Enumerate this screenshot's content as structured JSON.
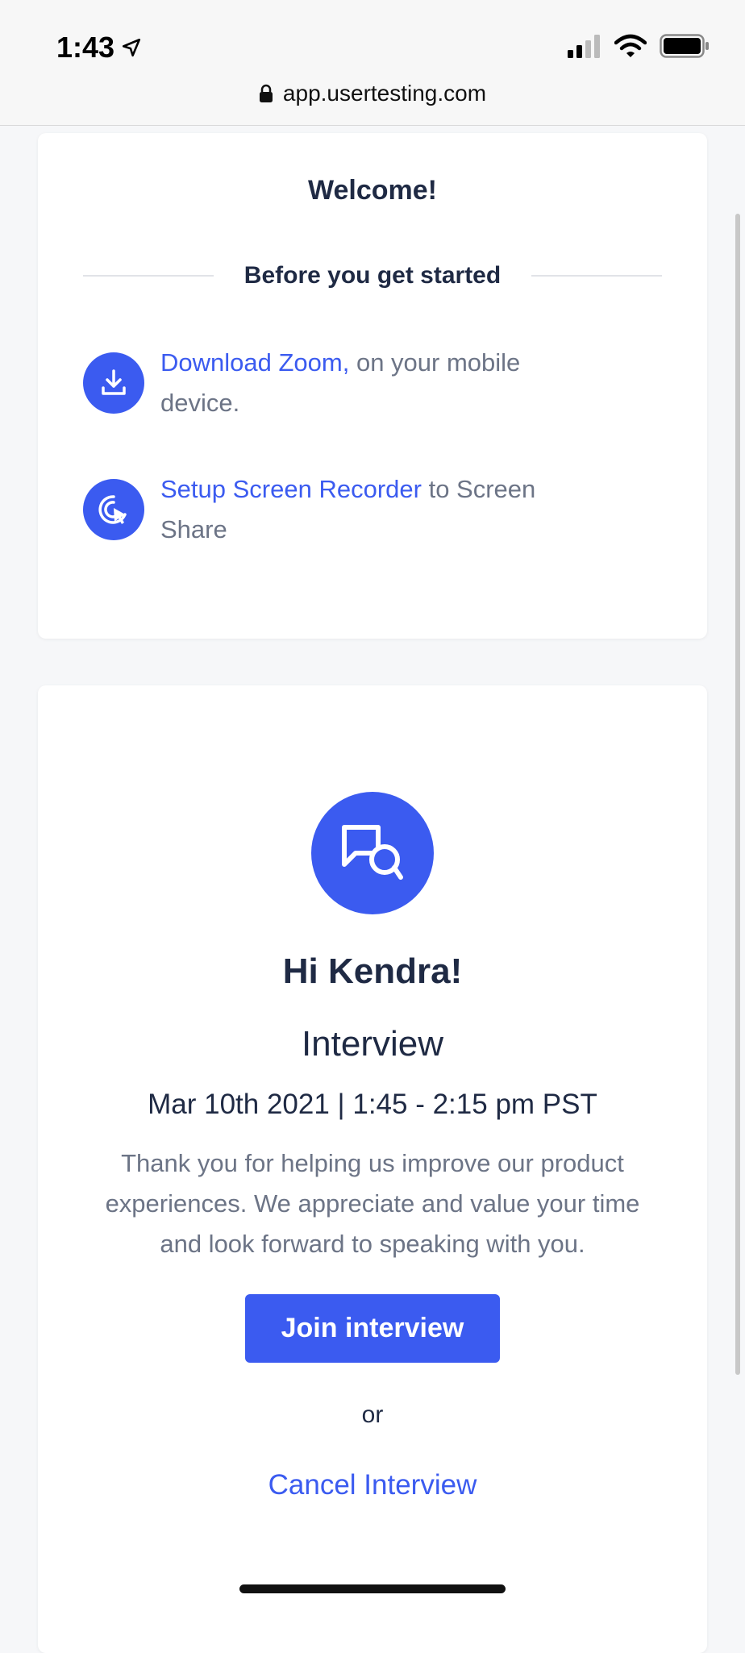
{
  "status_bar": {
    "time": "1:43",
    "url": "app.usertesting.com"
  },
  "welcome_card": {
    "title": "Welcome!",
    "section_heading": "Before you get started",
    "steps": [
      {
        "link": "Download Zoom,",
        "rest": " on your mobile device.",
        "icon": "download-icon"
      },
      {
        "link": "Setup Screen Recorder",
        "rest": " to Screen Share",
        "icon": "screen-recorder-icon"
      }
    ]
  },
  "session_card": {
    "icon": "chat-bubbles-icon",
    "greeting": "Hi Kendra!",
    "session_type": "Interview",
    "session_time": "Mar 10th 2021 | 1:45 - 2:15 pm PST",
    "message": "Thank you for helping us improve our product experiences. We appreciate and value your time and look forward to speaking with you.",
    "join_label": "Join interview",
    "or_label": "or",
    "cancel_label": "Cancel Interview"
  },
  "colors": {
    "accent": "#3b5bf0",
    "heading": "#1f2a44",
    "muted": "#6c7486"
  }
}
